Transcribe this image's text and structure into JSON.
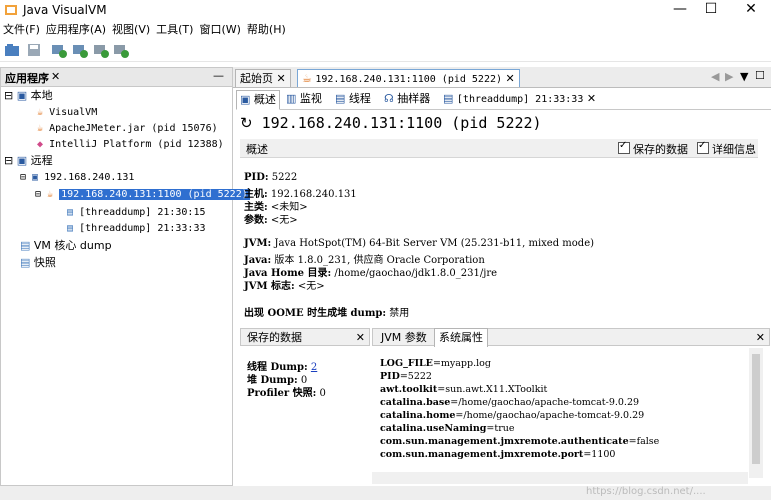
{
  "window": {
    "title": "Java VisualVM",
    "minimize": "—",
    "maximize": "☐",
    "close": "✕"
  },
  "menu": [
    "文件(F)",
    "应用程序(A)",
    "视图(V)",
    "工具(T)",
    "窗口(W)",
    "帮助(H)"
  ],
  "left_panel": {
    "title": "应用程序",
    "close": "✕",
    "minimize": "—",
    "tree": {
      "local": "本地",
      "visualvm": "VisualVM",
      "jmeter": "ApacheJMeter.jar (pid 15076)",
      "intellij": "IntelliJ Platform (pid 12388)",
      "remote": "远程",
      "host": "192.168.240.131",
      "jmx": "192.168.240.131:1100 (pid 5222)",
      "threaddump1": "[threaddump] 21:30:15",
      "threaddump2": "[threaddump] 21:33:33",
      "vm_core": "VM 核心 dump",
      "snapshot": "快照"
    }
  },
  "top_tabs": {
    "start": "起始页",
    "jmx": "192.168.240.131:1100 (pid 5222)",
    "close": "✕",
    "nav_prev": "◀",
    "nav_next": "▶",
    "menu": "▼",
    "restore": "☐"
  },
  "sub_tabs": {
    "overview": "概述",
    "monitor": "监视",
    "threads": "线程",
    "sampler": "抽样器",
    "threaddump": "[threaddump] 21:33:33",
    "close": "✕"
  },
  "heading": {
    "host": "192.168.240.131:1100",
    "pid": "(pid 5222)"
  },
  "overview_bar": {
    "label": "概述",
    "saved_data": "保存的数据",
    "details": "详细信息"
  },
  "info": {
    "pid_label": "PID:",
    "pid": "5222",
    "host_label": "主机:",
    "host": "192.168.240.131",
    "mainclass_label": "主类:",
    "mainclass": "<未知>",
    "args_label": "参数:",
    "args": "<无>",
    "jvm_label": "JVM:",
    "jvm": "Java HotSpot(TM) 64-Bit Server VM (25.231-b11, mixed mode)",
    "java_label": "Java:",
    "java": "版本 1.8.0_231, 供应商 Oracle Corporation",
    "javahome_label": "Java Home 目录:",
    "javahome": "/home/gaochao/jdk1.8.0_231/jre",
    "jvmflags_label": "JVM 标志:",
    "jvmflags": "<无>",
    "oome_label": "出现 OOME 时生成堆 dump:",
    "oome": "禁用"
  },
  "saved_pane": {
    "title": "保存的数据",
    "close": "✕",
    "thread_dump_label": "线程 Dump:",
    "thread_dump": "2",
    "heap_dump_label": "堆 Dump:",
    "heap_dump": "0",
    "profiler_label": "Profiler 快照:",
    "profiler": "0"
  },
  "jvm_pane": {
    "tab_args": "JVM 参数",
    "tab_sysprops": "系统属性",
    "close": "✕",
    "props": [
      {
        "k": "LOG_FILE",
        "v": "=myapp.log"
      },
      {
        "k": "PID",
        "v": "=5222"
      },
      {
        "k": "awt.toolkit",
        "v": "=sun.awt.X11.XToolkit"
      },
      {
        "k": "catalina.base",
        "v": "=/home/gaochao/apache-tomcat-9.0.29"
      },
      {
        "k": "catalina.home",
        "v": "=/home/gaochao/apache-tomcat-9.0.29"
      },
      {
        "k": "catalina.useNaming",
        "v": "=true"
      },
      {
        "k": "com.sun.management.jmxremote.authenticate",
        "v": "=false"
      },
      {
        "k": "com.sun.management.jmxremote.port",
        "v": "=1100"
      }
    ]
  },
  "watermark": "https://blog.csdn.net/...."
}
